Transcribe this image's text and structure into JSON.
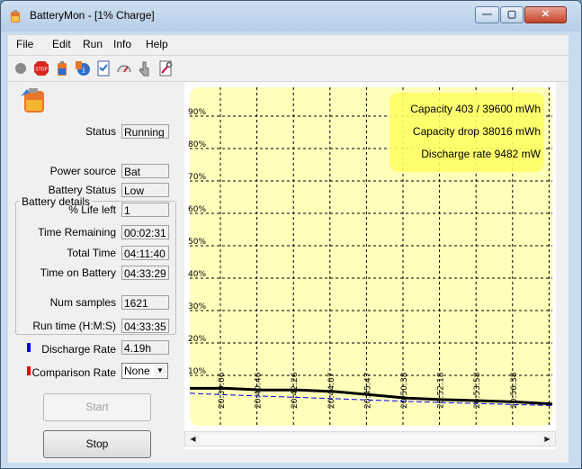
{
  "window": {
    "title": "BatteryMon - [1% Charge]",
    "buttons": {
      "minimize": "—",
      "maximize": "▢",
      "close": "✕"
    }
  },
  "menu": [
    "File",
    "Edit",
    "Run",
    "Info",
    "Help"
  ],
  "toolbar_icons": [
    "record-icon",
    "stop-sign-icon",
    "battery-icon",
    "info-icon",
    "checklist-icon",
    "gauge-icon",
    "pointer-icon",
    "wrench-icon"
  ],
  "status": {
    "label": "Status",
    "value": "Running"
  },
  "battery_details": {
    "title": "Battery details",
    "rows": [
      {
        "label": "Power source",
        "value": "Bat"
      },
      {
        "label": "Battery Status",
        "value": "Low"
      },
      {
        "label": "% Life left",
        "value": "1"
      },
      {
        "label": "Time Remaining",
        "value": "00:02:31"
      },
      {
        "label": "Total Time",
        "value": "04:11:40"
      },
      {
        "label": "Time on Battery",
        "value": "04:33:29"
      }
    ]
  },
  "stats": [
    {
      "label": "Num samples",
      "value": "1621"
    },
    {
      "label": "Run time (H:M:S)",
      "value": "04:33:35"
    },
    {
      "label": "Discharge Rate",
      "value": "4.19h"
    }
  ],
  "comparison": {
    "label": "Comparison Rate",
    "selected": "None"
  },
  "buttons": {
    "start": "Start",
    "stop": "Stop"
  },
  "colors": {
    "discharge": "#0000ee",
    "comparison": "#ee0000",
    "chart_bg": "#ffffbb",
    "info_box": "#ffff66"
  },
  "chart_data": {
    "type": "line",
    "y_ticks": [
      "10%",
      "20%",
      "30%",
      "40%",
      "50%",
      "60%",
      "70%",
      "80%",
      "90%"
    ],
    "x_ticks": [
      "20:39:06",
      "20:40:46",
      "20:42:26",
      "20:44:07",
      "20:45:47",
      "20:50:38",
      "20:52:18",
      "20:53:58",
      "20:56:38"
    ],
    "ylim": [
      0,
      100
    ],
    "grid": true,
    "series": [
      {
        "values": [
          6,
          6,
          5.5,
          5.5,
          5,
          4,
          3,
          2.5,
          2.2,
          1.8,
          1.2
        ]
      },
      {
        "values": [
          4.5,
          4,
          3.6,
          3.2,
          2.8,
          2.4,
          2,
          1.6,
          1.3,
          1,
          0.7
        ]
      }
    ],
    "info": [
      "Capacity 403 / 39600 mWh",
      "Capacity drop 38016 mWh",
      "Discharge rate 9482 mW"
    ]
  }
}
